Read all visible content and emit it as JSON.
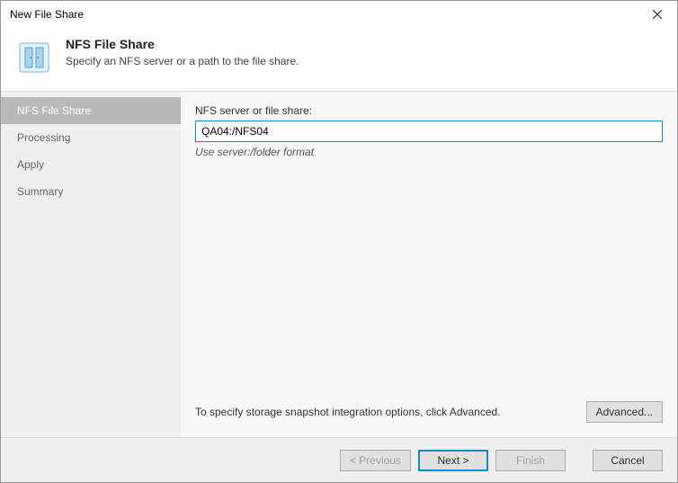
{
  "window": {
    "title": "New File Share"
  },
  "header": {
    "title": "NFS File Share",
    "subtitle": "Specify an NFS server or a path to the file share."
  },
  "sidebar": {
    "steps": [
      {
        "label": "NFS File Share",
        "active": true
      },
      {
        "label": "Processing",
        "active": false
      },
      {
        "label": "Apply",
        "active": false
      },
      {
        "label": "Summary",
        "active": false
      }
    ]
  },
  "main": {
    "field_label": "NFS server or file share:",
    "field_value": "QA04:/NFS04",
    "hint": "Use server:/folder format",
    "advanced_note": "To specify storage snapshot integration options, click Advanced.",
    "advanced_button": "Advanced..."
  },
  "footer": {
    "previous": "< Previous",
    "next": "Next >",
    "finish": "Finish",
    "cancel": "Cancel"
  }
}
